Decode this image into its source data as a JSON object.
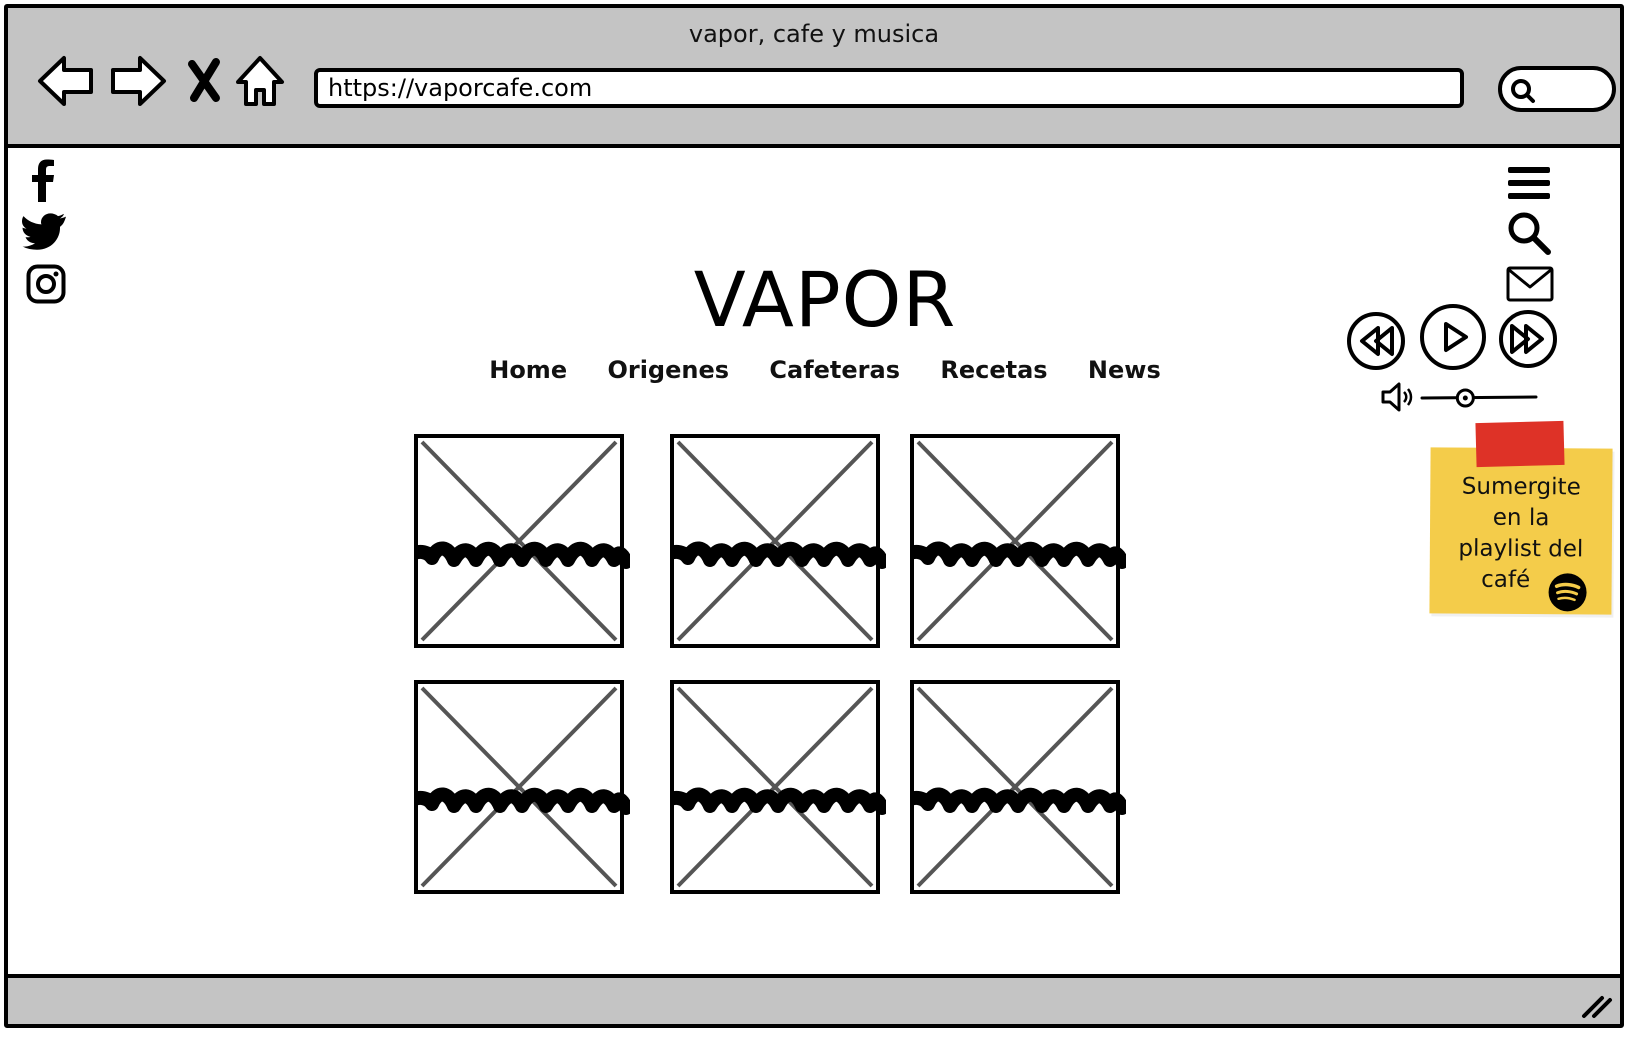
{
  "window": {
    "title": "vapor, cafe y musica",
    "url": "https://vaporcafe.com"
  },
  "social": [
    "facebook-icon",
    "twitter-icon",
    "instagram-icon"
  ],
  "site": {
    "brand": "VAPOR",
    "nav": [
      "Home",
      "Origenes",
      "Cafeteras",
      "Recetas",
      "News"
    ]
  },
  "tiles_count": 6,
  "player": {
    "controls": [
      "rewind-icon",
      "play-icon",
      "fast-forward-icon"
    ],
    "volume_level": 0.38
  },
  "note": {
    "lines": [
      "Sumergite",
      "en la",
      "playlist del",
      "café"
    ]
  },
  "colors": {
    "chrome": "#c4c4c4",
    "note": "#f4cc4a",
    "tape": "#de3227"
  }
}
